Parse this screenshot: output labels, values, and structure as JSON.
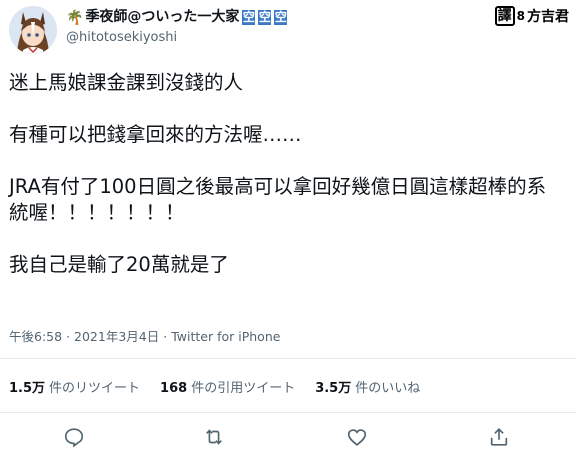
{
  "author": {
    "palm_icon": "🌴",
    "display_name": "季夜師@ついった一大家",
    "badges": [
      "空",
      "空",
      "空"
    ],
    "handle": "@hitotosekiyoshi"
  },
  "translator": {
    "mark": "譯",
    "separator": "8",
    "name": "方吉君"
  },
  "tweet": {
    "paragraphs": [
      "迷上馬娘課金課到沒錢的人",
      "有種可以把錢拿回來的方法喔……",
      "JRA有付了100日圓之後最高可以拿回好幾億日圓這樣超棒的系統喔！！！！！！！",
      "我自己是輸了20萬就是了"
    ]
  },
  "meta": {
    "time": "午後6:58",
    "date": "2021年3月4日",
    "source": "Twitter for iPhone",
    "separator": "·"
  },
  "stats": [
    {
      "count": "1.5万",
      "label": "件のリツイート"
    },
    {
      "count": "168",
      "label": "件の引用ツイート"
    },
    {
      "count": "3.5万",
      "label": "件のいいね"
    }
  ],
  "colors": {
    "badge": "#3a78c8",
    "secondary_text": "#536471",
    "divider": "#e6ecf0"
  }
}
